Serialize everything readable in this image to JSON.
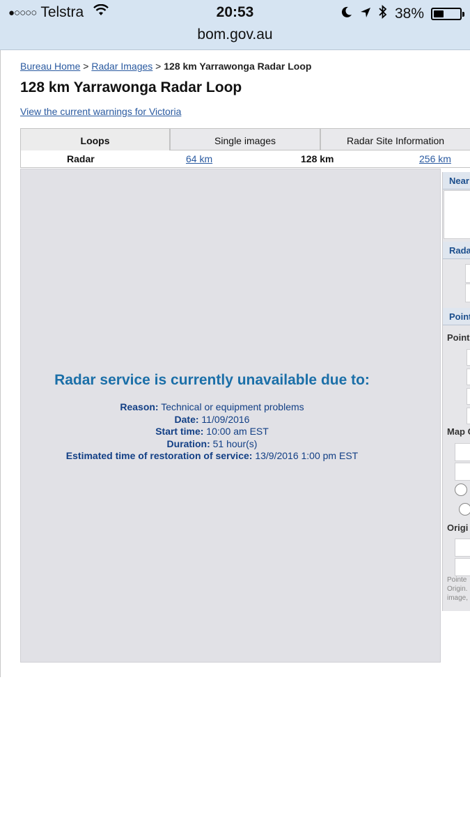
{
  "status_bar": {
    "carrier": "Telstra",
    "signal_dots": "●○○○○",
    "time": "20:53",
    "battery_percent": "38%",
    "battery_level": 0.38,
    "url": "bom.gov.au"
  },
  "breadcrumb": {
    "home": "Bureau Home",
    "sep1": " > ",
    "radar_images": "Radar Images",
    "sep2": " > ",
    "current": "128 km Yarrawonga Radar Loop"
  },
  "page_title": "128 km Yarrawonga Radar Loop",
  "warnings_link": "View the current warnings for Victoria",
  "tabs": [
    {
      "label": "Loops"
    },
    {
      "label": "Single images"
    },
    {
      "label": "Radar Site Information"
    }
  ],
  "range_row": {
    "label": "Radar",
    "r64": "64 km",
    "r128": "128 km",
    "r256": "256 km"
  },
  "outage": {
    "heading": "Radar service is currently unavailable due to:",
    "reason_label": "Reason:",
    "reason_value": " Technical or equipment problems",
    "date_label": "Date:",
    "date_value": " 11/09/2016",
    "start_label": "Start time:",
    "start_value": " 10:00 am EST",
    "duration_label": "Duration:",
    "duration_value": " 51 hour(s)",
    "eta_label": "Estimated time of restoration of service:",
    "eta_value": " 13/9/2016 1:00 pm EST"
  },
  "side_panel": {
    "h1": "Near",
    "h2": "Rada",
    "h3": "Point",
    "l1": "Point",
    "l2": "Map C",
    "l3": "Origi",
    "n1": "Pointe",
    "n2": "Origin.",
    "n3": "image,"
  }
}
